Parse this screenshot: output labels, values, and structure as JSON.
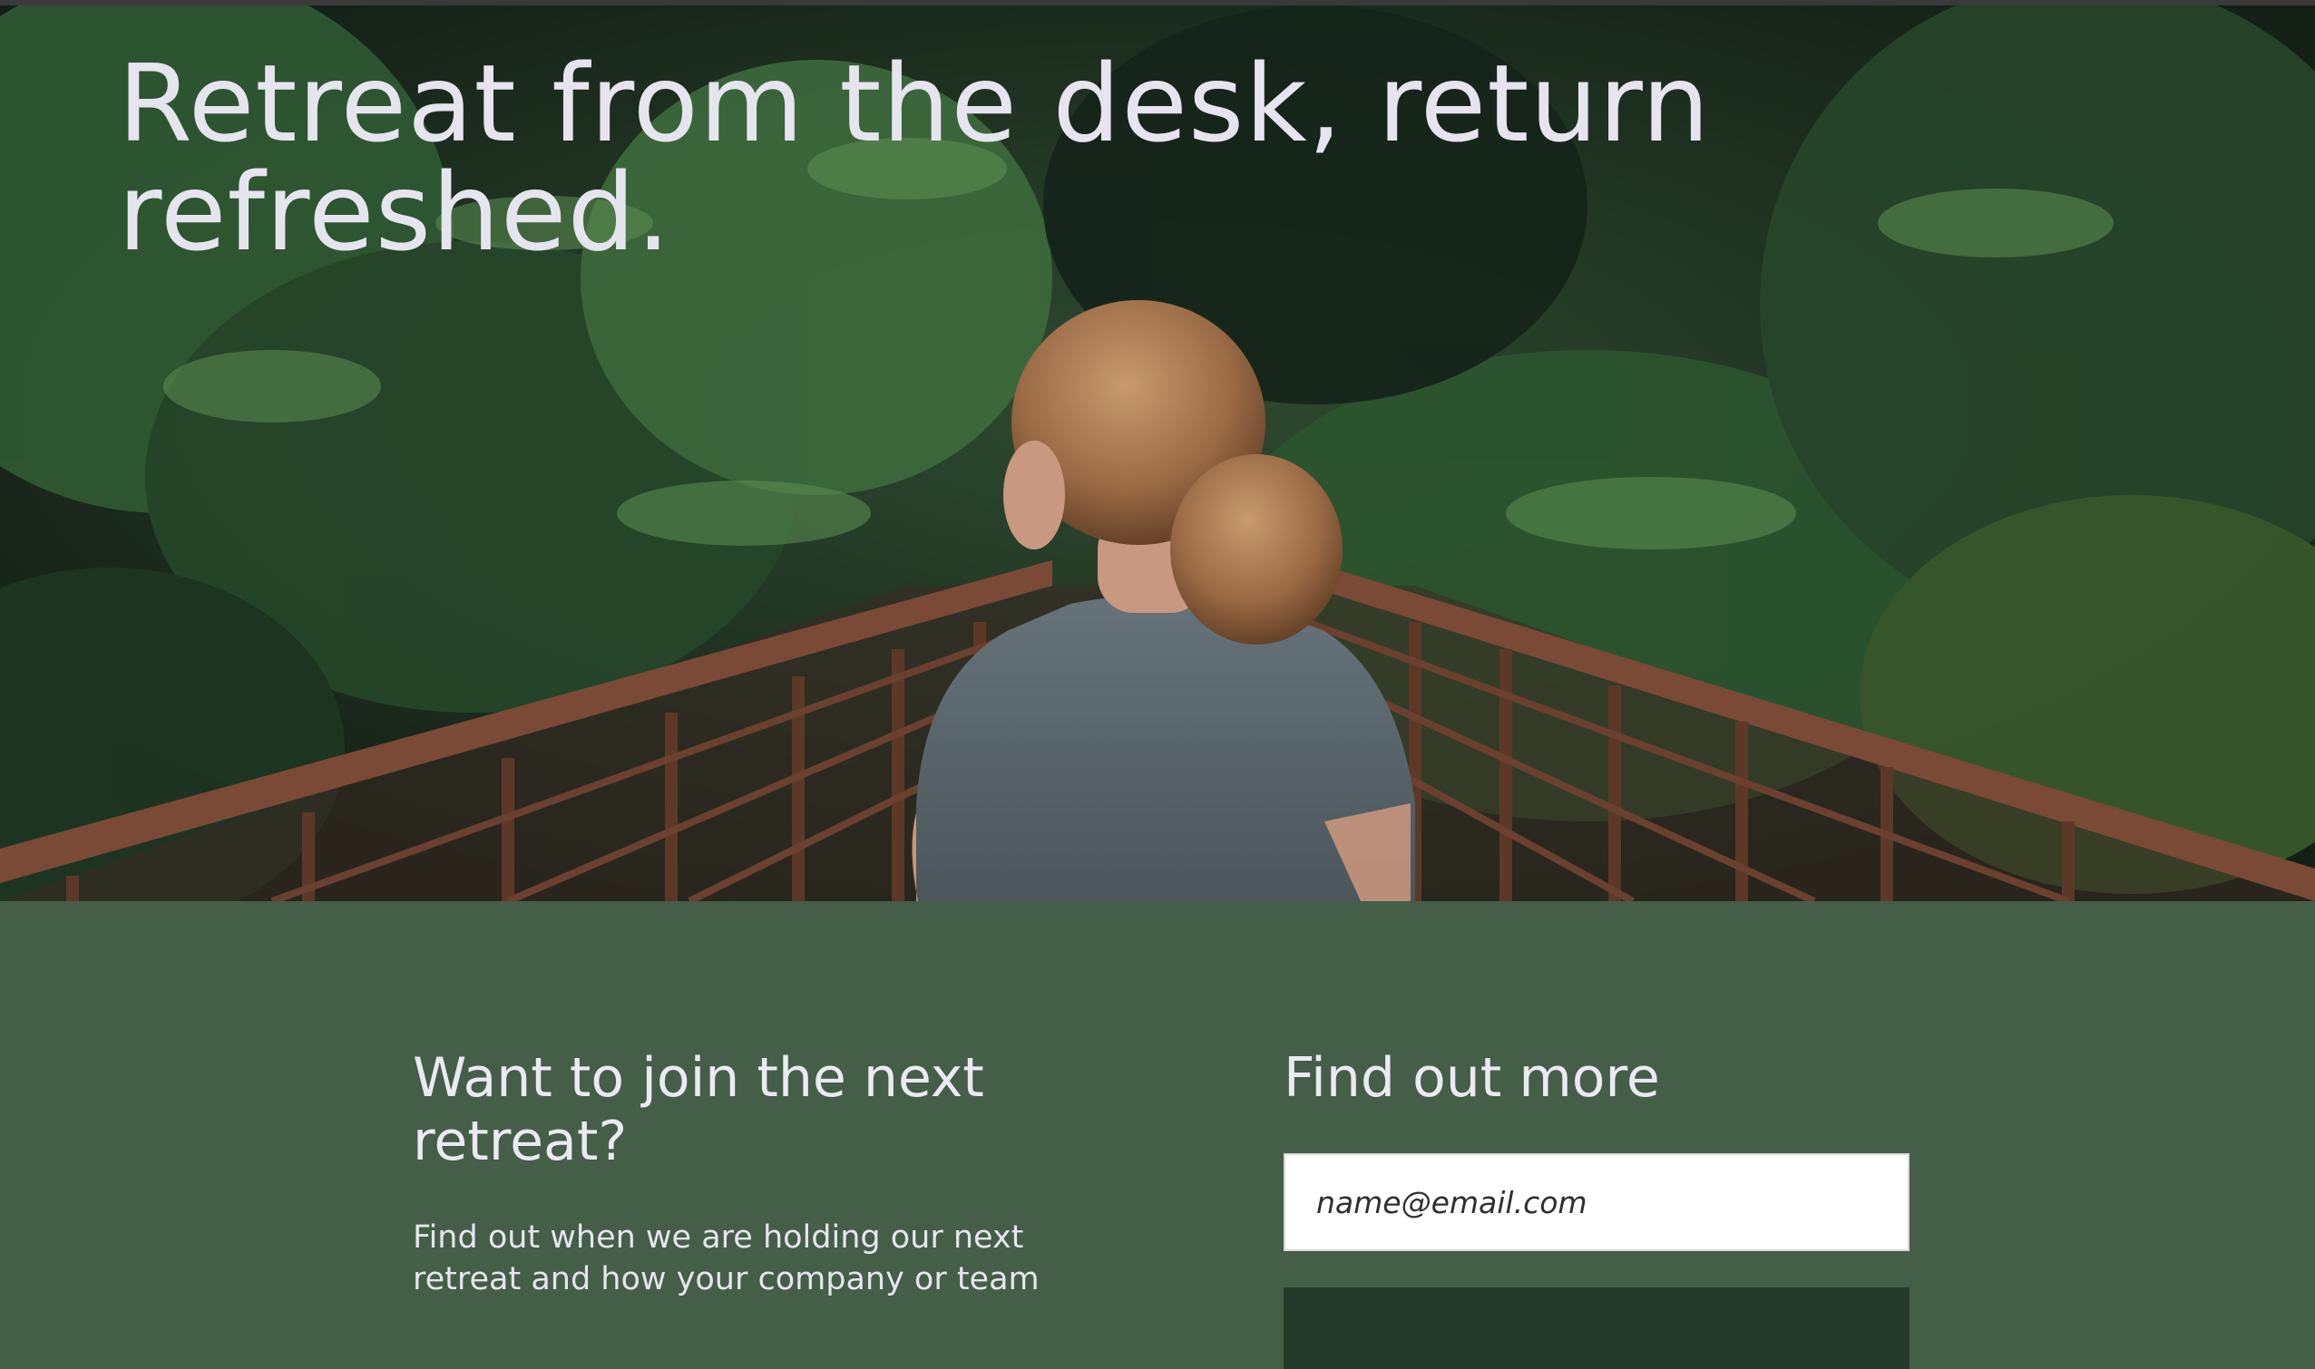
{
  "hero": {
    "title": "Retreat from the desk, return refreshed.",
    "image_alt": "photo-woman-on-forest-bridge"
  },
  "signup": {
    "left": {
      "heading": "Want to join the next retreat?",
      "body": "Find out when we are holding our next retreat and how your company or team"
    },
    "right": {
      "heading": "Find out more",
      "email_placeholder": "name@email.com",
      "submit_label": ""
    }
  },
  "colors": {
    "section_green": "#445e47",
    "button_dark_green": "#253a2a",
    "heading_text": "#e6e4ef"
  }
}
